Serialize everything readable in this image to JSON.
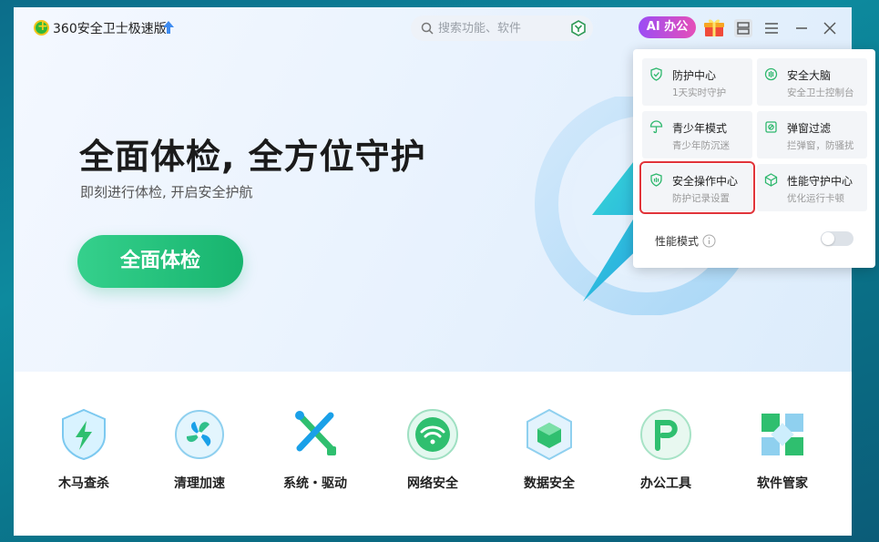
{
  "titlebar": {
    "app_title": "360安全卫士极速版",
    "search_placeholder": "搜索功能、软件",
    "ai_label": "AI 办公"
  },
  "hero": {
    "headline": "全面体检, 全方位守护",
    "subline": "即刻进行体检, 开启安全护航",
    "check_button": "全面体检"
  },
  "tools": [
    {
      "label": "木马查杀",
      "icon": "trojan-shield-icon"
    },
    {
      "label": "清理加速",
      "icon": "cleanup-fan-icon"
    },
    {
      "label": "系统・驱动",
      "icon": "system-tools-icon"
    },
    {
      "label": "网络安全",
      "icon": "wifi-icon"
    },
    {
      "label": "数据安全",
      "icon": "data-cube-icon"
    },
    {
      "label": "办公工具",
      "icon": "office-p-icon"
    },
    {
      "label": "软件管家",
      "icon": "software-manager-icon"
    }
  ],
  "popup": {
    "cards": [
      {
        "title": "防护中心",
        "sub": "1天实时守护",
        "icon": "shield-check-icon"
      },
      {
        "title": "安全大脑",
        "sub": "安全卫士控制台",
        "icon": "brain-icon"
      },
      {
        "title": "青少年模式",
        "sub": "青少年防沉迷",
        "icon": "umbrella-icon"
      },
      {
        "title": "弹窗过滤",
        "sub": "拦弹窗，防骚扰",
        "icon": "popup-filter-icon"
      },
      {
        "title": "安全操作中心",
        "sub": "防护记录设置",
        "icon": "shield-log-icon"
      },
      {
        "title": "性能守护中心",
        "sub": "优化运行卡顿",
        "icon": "perf-cube-icon"
      }
    ],
    "perf_mode_label": "性能模式",
    "perf_mode_on": false
  },
  "colors": {
    "accent_green": "#1fbf78",
    "highlight_red": "#e1343a",
    "ai_gradient_start": "#9b4df5",
    "ai_gradient_end": "#e54fb8"
  }
}
